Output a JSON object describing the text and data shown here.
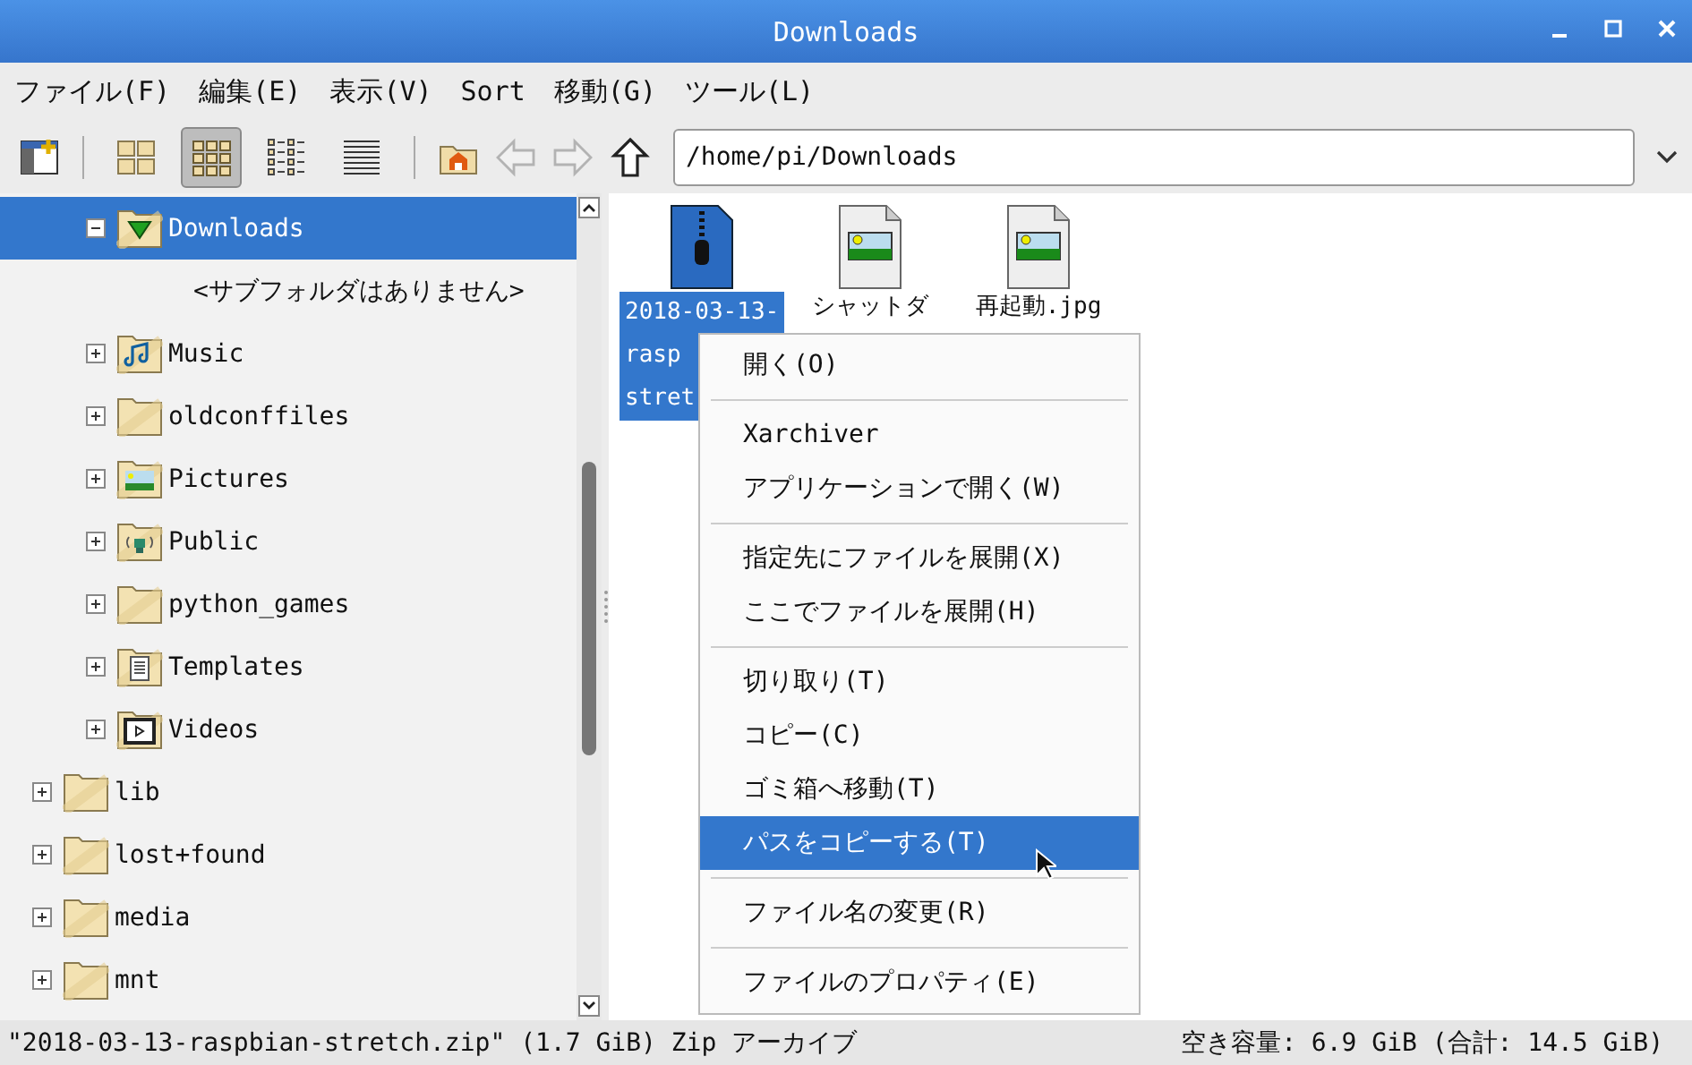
{
  "window": {
    "title": "Downloads"
  },
  "menu_bar": [
    "ファイル(F)",
    "編集(E)",
    "表示(V)",
    "Sort",
    "移動(G)",
    "ツール(L)"
  ],
  "toolbar": {
    "view_modes": [
      {
        "kind": "icons",
        "selected": false
      },
      {
        "kind": "thumbnails",
        "selected": true
      },
      {
        "kind": "compact",
        "selected": false
      },
      {
        "kind": "list",
        "selected": false
      }
    ],
    "navigation": [
      {
        "kind": "home",
        "disabled": false
      },
      {
        "kind": "back",
        "disabled": true
      },
      {
        "kind": "forward",
        "disabled": true
      },
      {
        "kind": "up",
        "disabled": false
      }
    ],
    "path": "/home/pi/Downloads"
  },
  "tree": {
    "scrolled_parent_children": [
      {
        "label": "Downloads",
        "kind": "downloads",
        "expanded": true,
        "selected": true,
        "children": [
          {
            "label": "<サブフォルダはありません>"
          }
        ]
      },
      {
        "label": "Music",
        "kind": "music",
        "expanded": false,
        "selected": false
      },
      {
        "label": "oldconffiles",
        "kind": "folder",
        "expanded": false,
        "selected": false
      },
      {
        "label": "Pictures",
        "kind": "pictures",
        "expanded": false,
        "selected": false
      },
      {
        "label": "Public",
        "kind": "public",
        "expanded": false,
        "selected": false
      },
      {
        "label": "python_games",
        "kind": "folder",
        "expanded": false,
        "selected": false
      },
      {
        "label": "Templates",
        "kind": "templates",
        "expanded": false,
        "selected": false
      },
      {
        "label": "Videos",
        "kind": "videos",
        "expanded": false,
        "selected": false
      }
    ],
    "root_items": [
      {
        "label": "lib",
        "kind": "folder",
        "expanded": false,
        "selected": false
      },
      {
        "label": "lost+found",
        "kind": "folder",
        "expanded": false,
        "selected": false
      },
      {
        "label": "media",
        "kind": "folder",
        "expanded": false,
        "selected": false
      },
      {
        "label": "mnt",
        "kind": "folder",
        "expanded": false,
        "selected": false
      }
    ]
  },
  "files": [
    {
      "kind": "archive",
      "label_lines": [
        "2018-03-13-",
        "rasp",
        "stret"
      ],
      "selected": true
    },
    {
      "kind": "image",
      "label_lines": [
        "シャットダ"
      ],
      "selected": false
    },
    {
      "kind": "image",
      "label_lines": [
        "再起動.jpg"
      ],
      "selected": false
    }
  ],
  "context_menu": [
    [
      {
        "label": "開く(O)",
        "selected": false
      }
    ],
    [
      {
        "label": "Xarchiver",
        "selected": false
      },
      {
        "label": "アプリケーションで開く(W)",
        "selected": false
      }
    ],
    [
      {
        "label": "指定先にファイルを展開(X)",
        "selected": false
      },
      {
        "label": "ここでファイルを展開(H)",
        "selected": false
      }
    ],
    [
      {
        "label": "切り取り(T)",
        "selected": false
      },
      {
        "label": "コピー(C)",
        "selected": false
      },
      {
        "label": "ゴミ箱へ移動(T)",
        "selected": false
      },
      {
        "label": "パスをコピーする(T)",
        "selected": true
      }
    ],
    [
      {
        "label": "ファイル名の変更(R)",
        "selected": false
      }
    ],
    [
      {
        "label": "ファイルのプロパティ(E)",
        "selected": false
      }
    ]
  ],
  "status_bar": {
    "selection": "\"2018-03-13-raspbian-stretch.zip\" (1.7 GiB) Zip アーカイブ",
    "free_space": "空き容量: 6.9 GiB (合計: 14.5 GiB)"
  }
}
